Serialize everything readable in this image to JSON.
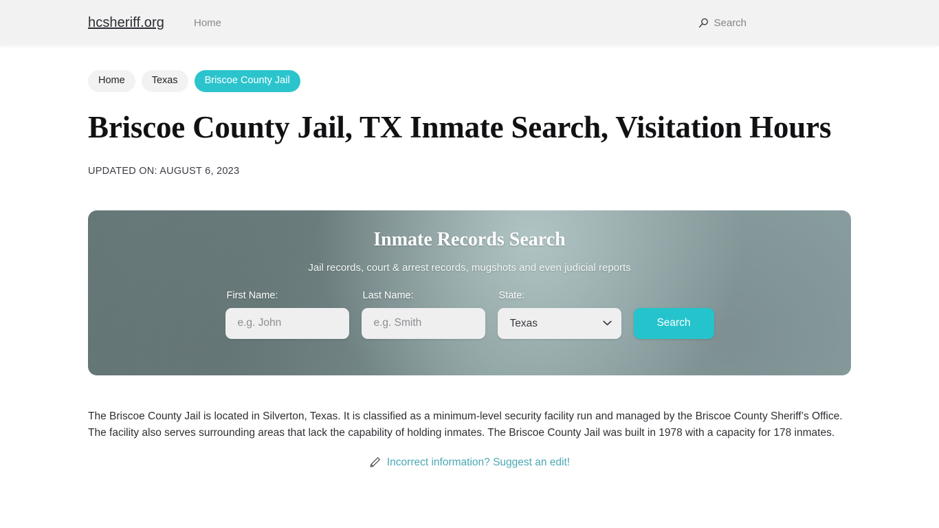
{
  "header": {
    "brand": "hcsheriff.org",
    "nav": [
      {
        "label": "Home"
      }
    ],
    "search": {
      "icon": "search-icon",
      "label": "Search"
    }
  },
  "breadcrumb": {
    "items": [
      {
        "label": "Home",
        "current": false
      },
      {
        "label": "Texas",
        "current": false
      },
      {
        "label": "Briscoe County Jail",
        "current": true
      }
    ]
  },
  "article": {
    "title": "Briscoe County Jail, TX Inmate Search, Visitation Hours",
    "updated": "UPDATED ON: AUGUST 6, 2023",
    "paragraph": "The Briscoe County Jail is located in Silverton, Texas. It is classified as a minimum-level security facility run and managed by the Briscoe County Sheriff’s Office. The facility also serves surrounding areas that lack the capability of holding inmates. The Briscoe County Jail was built in 1978 with a capacity for 178 inmates.",
    "suggest": {
      "icon": "pencil-icon",
      "label": "Incorrect information? Suggest an edit!"
    }
  },
  "search_panel": {
    "title": "Inmate Records Search",
    "subtitle": "Jail records, court & arrest records, mugshots and even judicial reports",
    "fields": {
      "first_name": {
        "label": "First Name:",
        "value": "",
        "placeholder": "e.g. John"
      },
      "last_name": {
        "label": "Last Name:",
        "value": "",
        "placeholder": "e.g. Smith"
      },
      "state": {
        "label": "State:",
        "selected": "Texas",
        "options": [
          "Texas"
        ]
      }
    },
    "submit_label": "Search"
  },
  "colors": {
    "accent_teal": "#25c4cd",
    "crumb_teal": "#2bc4cd",
    "link_teal": "#4aa8b4",
    "header_bg": "#f2f2f2",
    "input_bg": "#efefef",
    "title_text": "#111114"
  }
}
